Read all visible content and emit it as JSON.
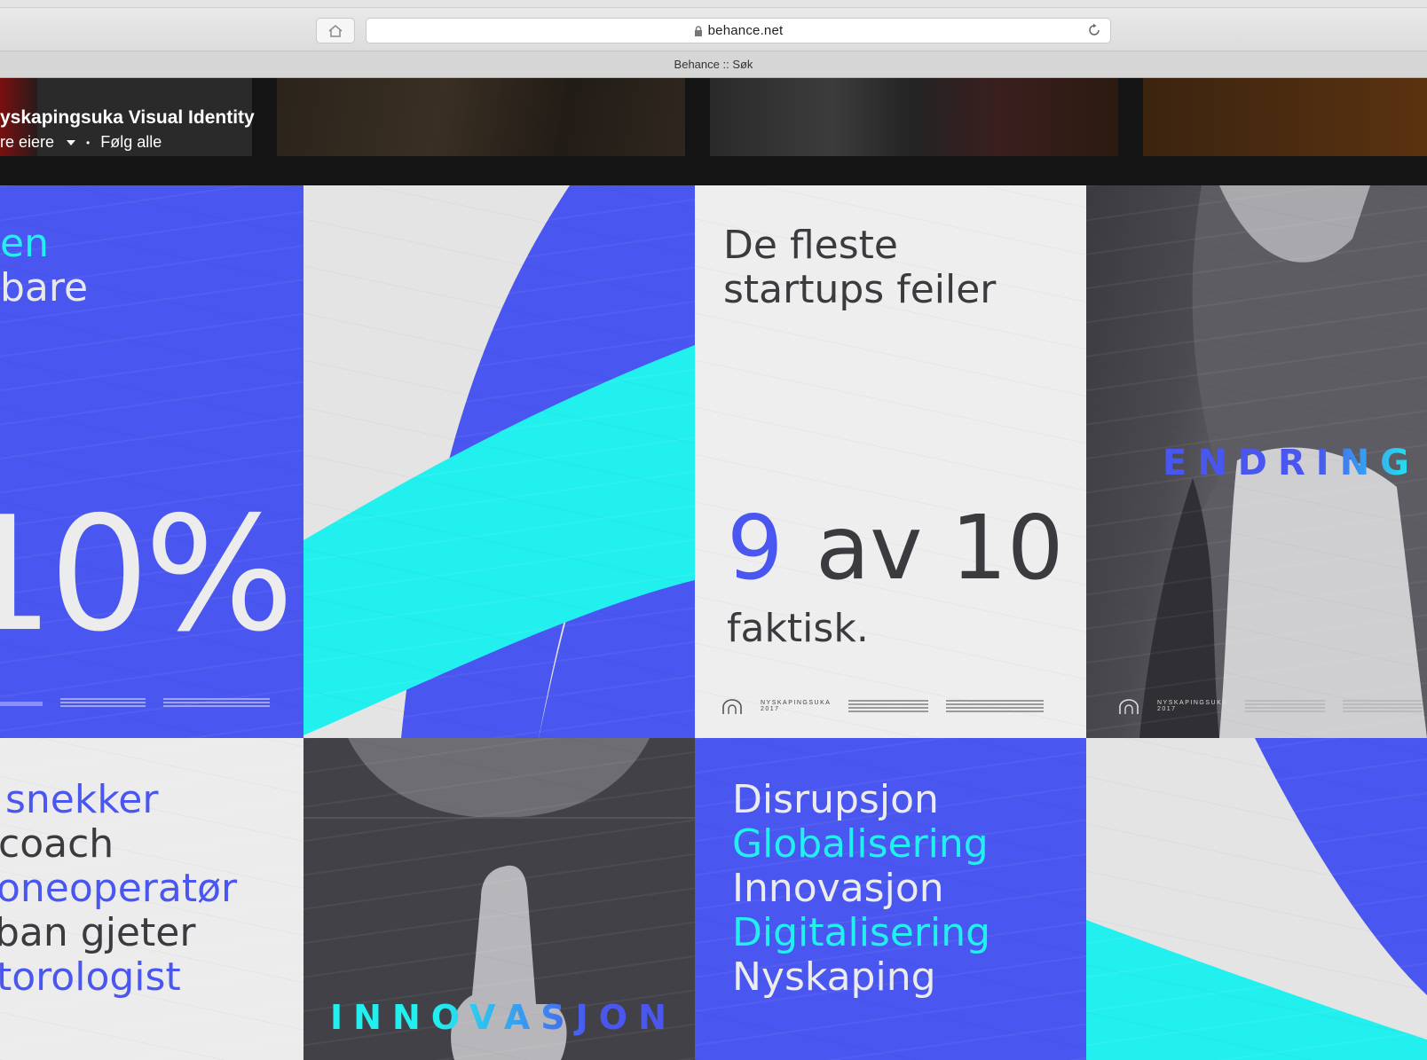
{
  "browser": {
    "url": "behance.net",
    "tab_title": "Behance :: Søk"
  },
  "header": {
    "project_title": "yskapingsuka Visual Identity",
    "owners_label": "re eiere",
    "separator": "•",
    "follow_all": "Følg alle"
  },
  "posters": {
    "p1": {
      "line1": "en",
      "line2": "bare",
      "percent": "10%"
    },
    "p3": {
      "line1": "De fleste",
      "line2": "startups feiler",
      "num_nine": "9",
      "num_rest": "av 10",
      "line3": "faktisk.",
      "brand": "NYSKAPINGSUKA",
      "brand_year": "2017"
    },
    "p4": {
      "word": "ENDRING",
      "brand": "NYSKAPINGSUKA",
      "brand_year": "2017"
    },
    "p5": {
      "items": [
        "snekker",
        "coach",
        "oneoperatør",
        "ban gjeter",
        "torologist"
      ]
    },
    "p6": {
      "word": "INNOVASJON"
    },
    "p7": {
      "items": [
        "Disrupsjon",
        "Globalisering",
        "Innovasjon",
        "Digitalisering",
        "Nyskaping"
      ]
    }
  },
  "colors": {
    "blue": "#4a56f0",
    "cyan": "#22f0ef",
    "light": "#e9e9e9",
    "dark": "#3f3f44",
    "ink": "#3a3a3f"
  },
  "icons": [
    "home-icon",
    "lock-icon",
    "reload-icon",
    "dropdown-caret-icon",
    "brand-arch-icon"
  ]
}
